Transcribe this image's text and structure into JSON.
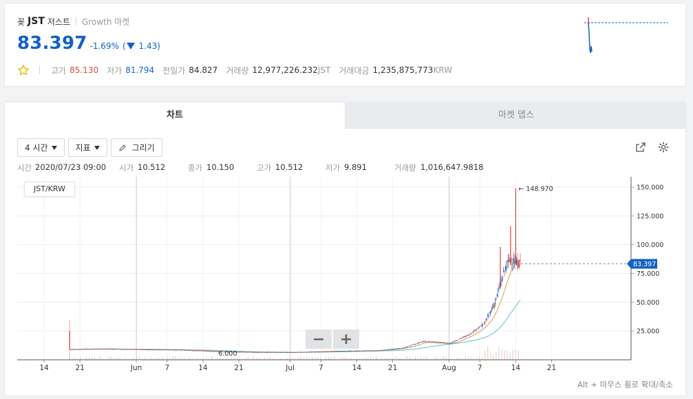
{
  "header": {
    "coin_logo": "꽂",
    "symbol": "JST",
    "coin_name": "저스트",
    "market": "Growth 마켓"
  },
  "price": {
    "current": "83.397",
    "change_pct": "-1.69%",
    "change_open": "(",
    "change_abs": "1.43)",
    "direction": "down"
  },
  "stats": {
    "high_label": "고가",
    "high": "85.130",
    "low_label": "저가",
    "low": "81.794",
    "prev_label": "전일가",
    "prev": "84.827",
    "volume_label": "거래량",
    "volume": "12,977,226.232",
    "volume_unit": "JST",
    "amount_label": "거래대금",
    "amount": "1,235,875,773",
    "amount_unit": "KRW"
  },
  "tabs": {
    "chart": "차트",
    "depth": "마켓 뎁스"
  },
  "toolbar": {
    "interval": "4 시간",
    "indicator": "지표",
    "draw": "그리기"
  },
  "ohlc": {
    "time_label": "시간",
    "time": "2020/07/23 09:00",
    "open_label": "시가",
    "open": "10.512",
    "close_label": "종가",
    "close": "10.150",
    "high_label": "고가",
    "high": "10.512",
    "low_label": "저가",
    "low": "9.891",
    "volume_label": "거래량",
    "volume": "1,016,647.9818"
  },
  "pair_label": "JST/KRW",
  "zoom": {
    "minus": "−",
    "plus": "+"
  },
  "hint": "Alt + 마우스 휠로 확대/축소",
  "colors": {
    "up": "#d24f45",
    "down": "#1261c4",
    "ma_short": "#e0a05a",
    "ma_long": "#6cc6d6",
    "price_tag": "#1261c4"
  },
  "chart_data": {
    "type": "candlestick",
    "ylim": [
      0,
      150
    ],
    "y_ticks": [
      "150.000",
      "125.000",
      "100.000",
      "75.000",
      "50.000",
      "25.000"
    ],
    "y_tick_values": [
      150,
      125,
      100,
      75,
      50,
      25
    ],
    "x_ticks": [
      "14",
      "21",
      "Jun",
      "7",
      "14",
      "21",
      "Jul",
      "7",
      "14",
      "21",
      "Aug",
      "7",
      "14",
      "21"
    ],
    "current_price": 83.397,
    "current_price_label": "83.397",
    "max_label": "148.970",
    "min_label": "6.000",
    "close_series": [
      {
        "date": "2020-05-19",
        "close": 9
      },
      {
        "date": "2020-05-25",
        "close": 9.5
      },
      {
        "date": "2020-06-01",
        "close": 9
      },
      {
        "date": "2020-06-10",
        "close": 8.5
      },
      {
        "date": "2020-06-18",
        "close": 7
      },
      {
        "date": "2020-06-25",
        "close": 6.5
      },
      {
        "date": "2020-07-02",
        "close": 6.5
      },
      {
        "date": "2020-07-10",
        "close": 7.5
      },
      {
        "date": "2020-07-18",
        "close": 8
      },
      {
        "date": "2020-07-23",
        "close": 10.15
      },
      {
        "date": "2020-07-27",
        "close": 16
      },
      {
        "date": "2020-08-01",
        "close": 14
      },
      {
        "date": "2020-08-05",
        "close": 22
      },
      {
        "date": "2020-08-08",
        "close": 32
      },
      {
        "date": "2020-08-10",
        "close": 50
      },
      {
        "date": "2020-08-11",
        "close": 65
      },
      {
        "date": "2020-08-12",
        "close": 80
      },
      {
        "date": "2020-08-13",
        "close": 88
      },
      {
        "date": "2020-08-14",
        "close": 84
      },
      {
        "date": "2020-08-15",
        "close": 83.397
      }
    ]
  }
}
